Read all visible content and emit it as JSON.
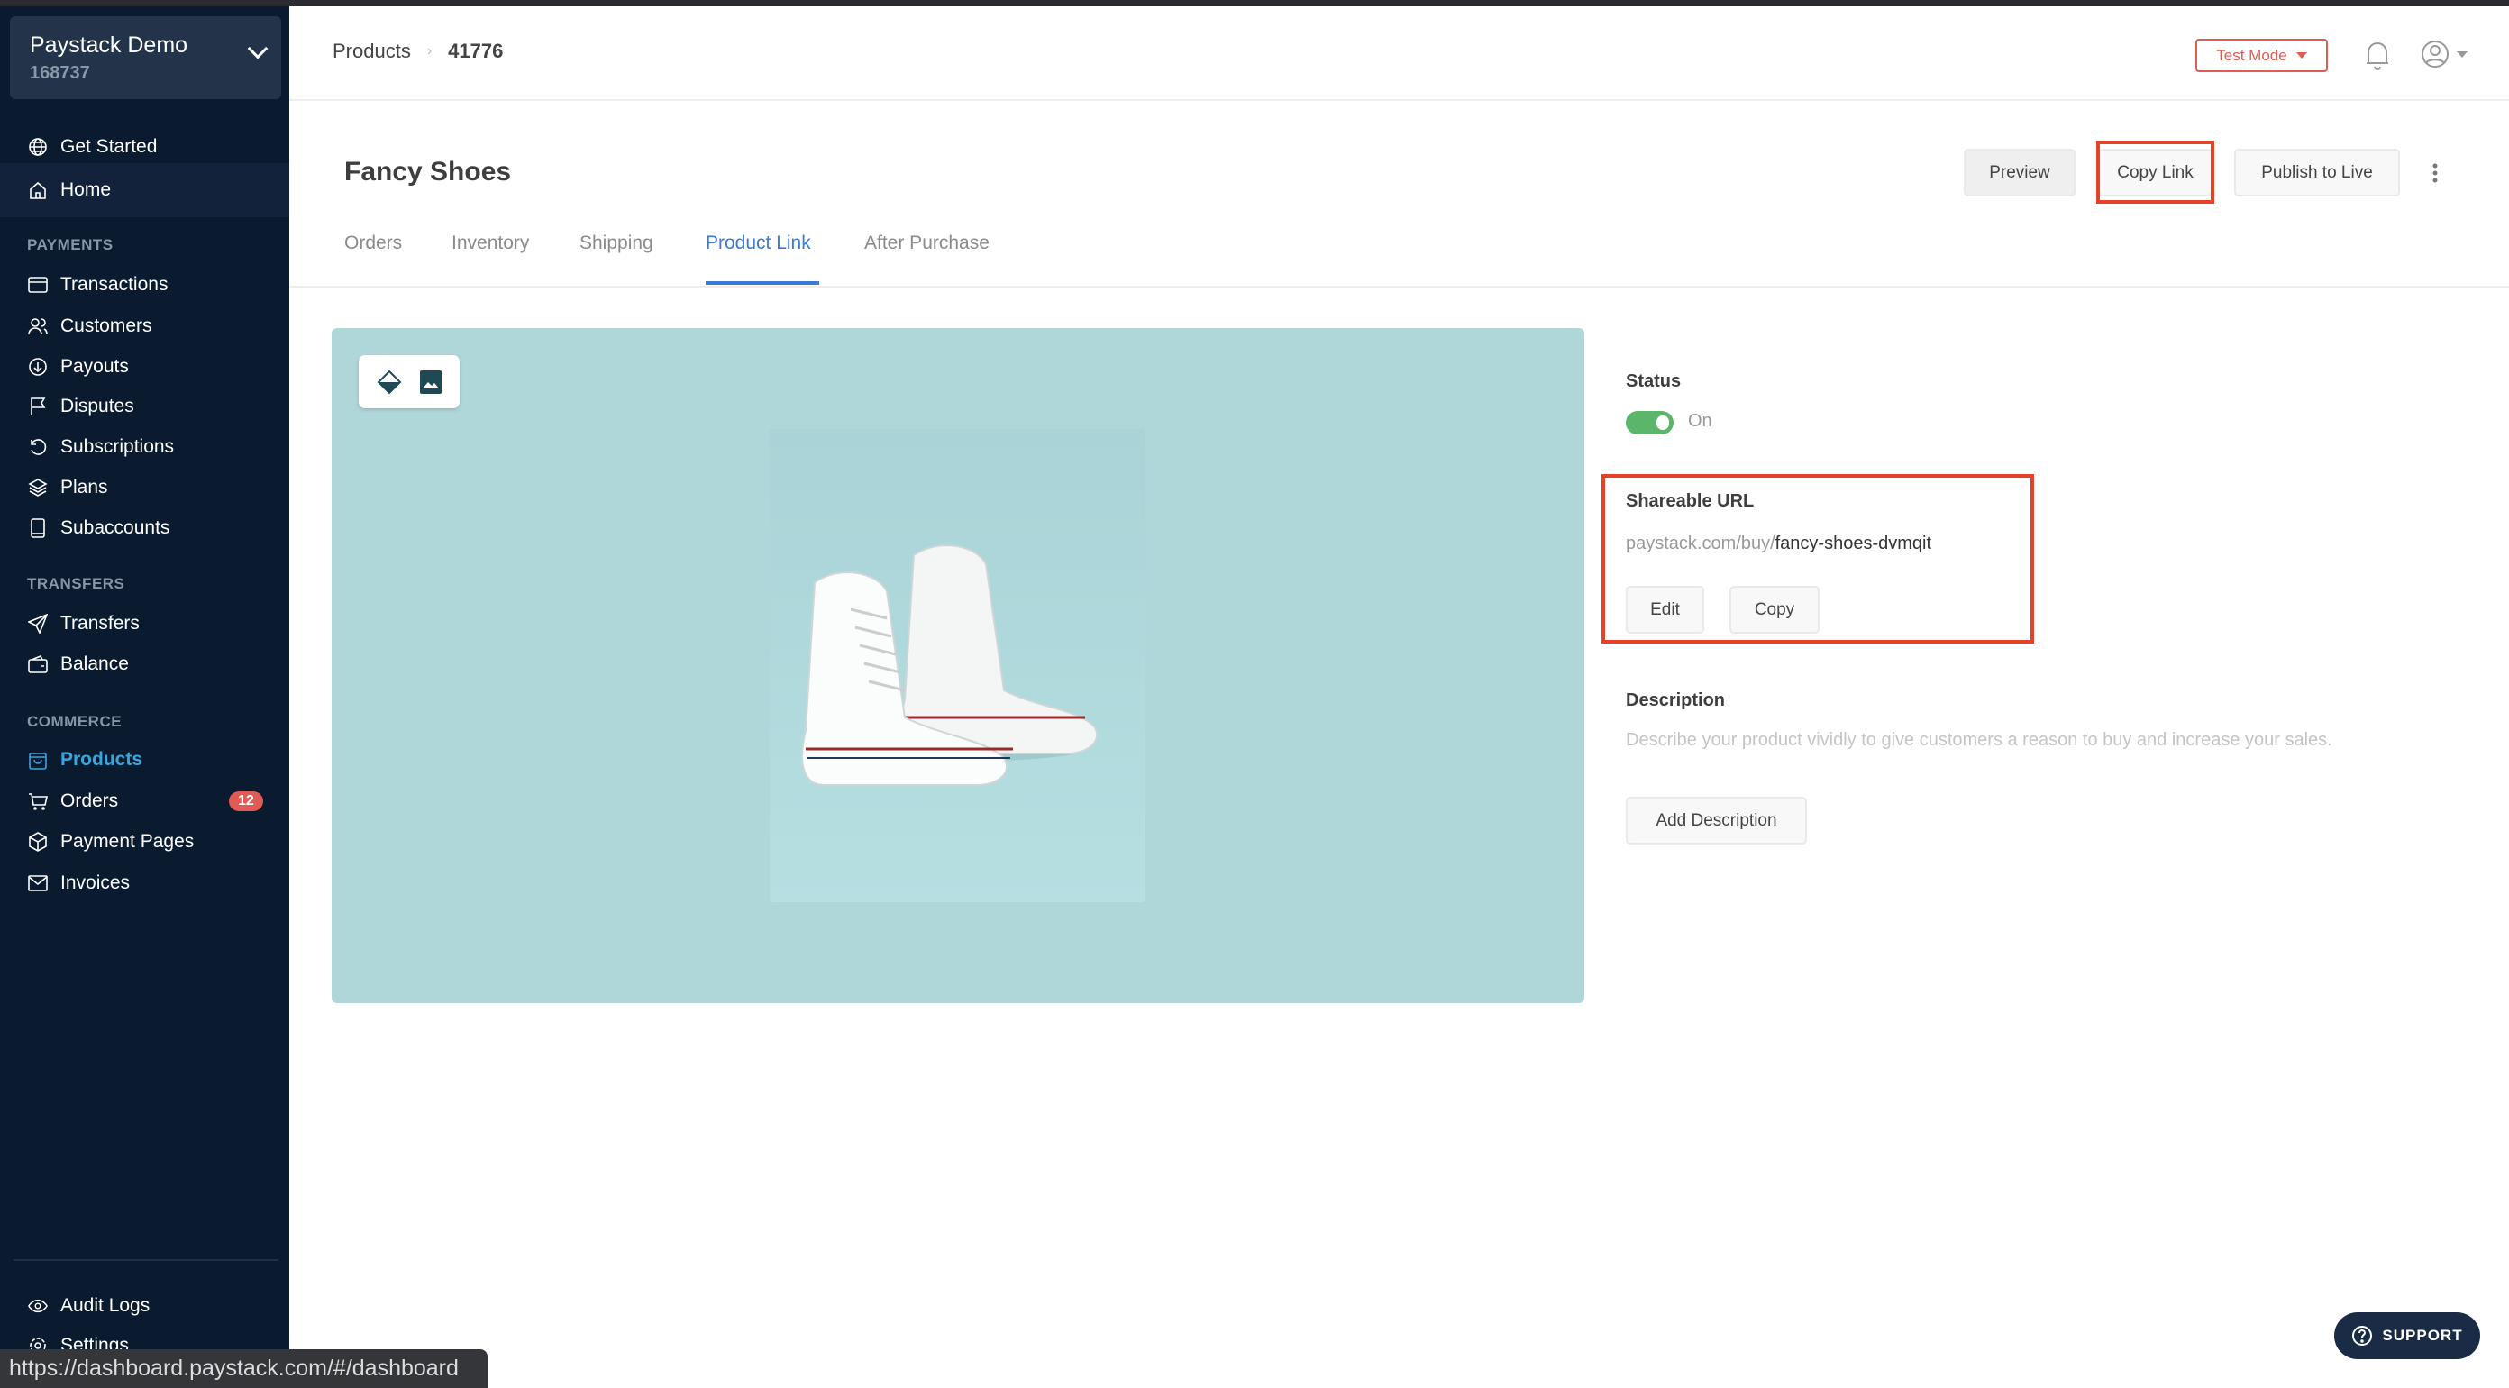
{
  "account": {
    "name": "Paystack Demo",
    "id": "168737"
  },
  "sidebar": {
    "top": [
      {
        "label": "Get Started",
        "icon": "globe-icon"
      },
      {
        "label": "Home",
        "icon": "home-icon"
      }
    ],
    "payments_title": "PAYMENTS",
    "payments": [
      {
        "label": "Transactions"
      },
      {
        "label": "Customers"
      },
      {
        "label": "Payouts"
      },
      {
        "label": "Disputes"
      },
      {
        "label": "Subscriptions"
      },
      {
        "label": "Plans"
      },
      {
        "label": "Subaccounts"
      }
    ],
    "transfers_title": "TRANSFERS",
    "transfers": [
      {
        "label": "Transfers"
      },
      {
        "label": "Balance"
      }
    ],
    "commerce_title": "COMMERCE",
    "commerce": [
      {
        "label": "Products",
        "active": true
      },
      {
        "label": "Orders",
        "badge": "12"
      },
      {
        "label": "Payment Pages"
      },
      {
        "label": "Invoices"
      }
    ],
    "bottom": [
      {
        "label": "Audit Logs"
      },
      {
        "label": "Settings"
      }
    ]
  },
  "header": {
    "breadcrumb": [
      "Products",
      "41776"
    ],
    "test_mode": "Test Mode"
  },
  "page": {
    "title": "Fancy Shoes",
    "tabs": [
      "Orders",
      "Inventory",
      "Shipping",
      "Product Link",
      "After Purchase"
    ],
    "active_tab": "Product Link",
    "actions": {
      "preview": "Preview",
      "copy_link": "Copy Link",
      "publish": "Publish to Live"
    }
  },
  "details": {
    "status_label": "Status",
    "status_value": "On",
    "status_on": true,
    "url_label": "Shareable URL",
    "url_prefix": "paystack.com/buy/",
    "url_slug": "fancy-shoes-dvmqit",
    "edit": "Edit",
    "copy": "Copy",
    "description_label": "Description",
    "description_placeholder": "Describe your product vividly to give customers a reason to buy and increase your sales.",
    "add_description": "Add Description"
  },
  "support": "SUPPORT",
  "status_bar_url": "https://dashboard.paystack.com/#/dashboard",
  "colors": {
    "sidebar": "#0a1b2f",
    "accent": "#3a7bd5",
    "danger": "#e05b53",
    "toggle_on": "#5cb66a",
    "image_bg": "#afd7da"
  }
}
